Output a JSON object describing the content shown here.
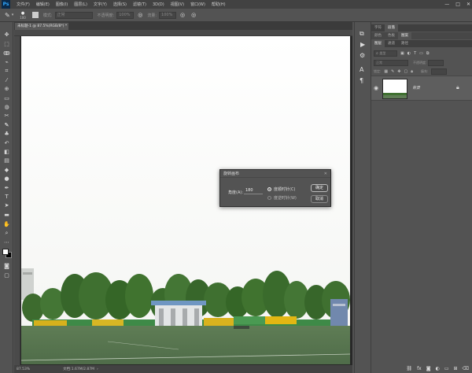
{
  "app": {
    "logo": "Ps"
  },
  "menu": [
    "文件(F)",
    "编辑(E)",
    "图像(I)",
    "图层(L)",
    "文字(Y)",
    "选择(S)",
    "滤镜(T)",
    "3D(D)",
    "视图(V)",
    "窗口(W)",
    "帮助(H)"
  ],
  "window_controls": {
    "minimize": "—",
    "maximize": "□",
    "close": "✕"
  },
  "options_bar": {
    "brush_size": "100",
    "mode_label": "模式:",
    "mode_value": "正常",
    "opacity_label": "不透明度:",
    "opacity_value": "100%",
    "flow_label": "流量:",
    "flow_value": "100%"
  },
  "document": {
    "tab_label": "未标题-1 @ 87.5%(RGB/8*) *",
    "close": "×",
    "zoom": "87.53%",
    "doc_info": "文档:1.67M/2.87M"
  },
  "panels": {
    "top_tabs": [
      "字符",
      "段落"
    ],
    "sub_tabs": [
      "颜色",
      "色板",
      "图案"
    ],
    "layers_tabs": [
      "图层",
      "通道",
      "路径"
    ],
    "kind_label": "类型",
    "blend_mode": "正常",
    "opacity_label": "不透明度:",
    "fill_label": "填充:",
    "lock_label": "锁定:",
    "layer_name": "背景",
    "icons": {
      "visibility": "eye-icon",
      "lock": "lock-icon"
    }
  },
  "dialog": {
    "title": "旋转画布",
    "close": "✕",
    "angle_label": "角度(A):",
    "angle_value": "180",
    "unit": "度",
    "cw_label": "度顺时针(C)",
    "ccw_label": "度逆时针(W)",
    "cw_selected": true,
    "ok": "确定",
    "cancel": "取消"
  },
  "colors": {
    "ui_dark": "#424242",
    "ui_mid": "#535353",
    "accent": "#31a8ff"
  }
}
